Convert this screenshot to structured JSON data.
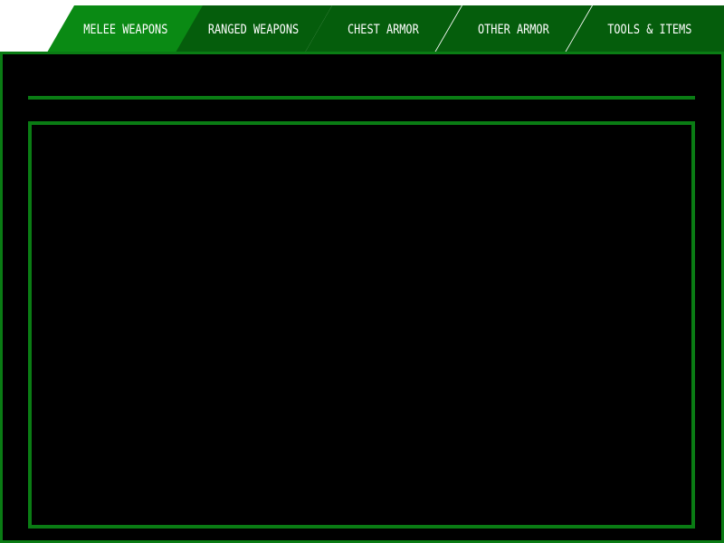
{
  "tabs": [
    {
      "label": "MELEE WEAPONS",
      "active": true
    },
    {
      "label": "RANGED WEAPONS",
      "active": false
    },
    {
      "label": "CHEST ARMOR",
      "active": false
    },
    {
      "label": "OTHER ARMOR",
      "active": false
    },
    {
      "label": "TOOLS & ITEMS",
      "active": false
    }
  ],
  "colors": {
    "active_tab": "#0a8a14",
    "inactive_tab": "#055d0c",
    "border": "#0a7c14",
    "panel_background": "#000000",
    "tab_text": "#ffffff"
  }
}
